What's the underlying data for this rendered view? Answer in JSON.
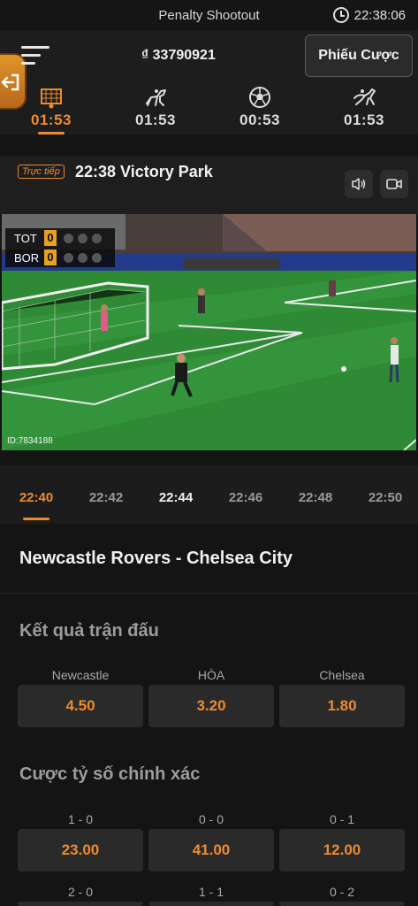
{
  "status": {
    "title": "Penalty Shootout",
    "clock": "22:38:06"
  },
  "header": {
    "balance": "₫ 33790921",
    "betslip_label": "Phiếu Cược",
    "sports": [
      {
        "icon": "goal-net-icon",
        "time": "01:53",
        "active": true
      },
      {
        "icon": "horse-racing-icon",
        "time": "01:53",
        "active": false
      },
      {
        "icon": "football-icon",
        "time": "00:53",
        "active": false
      },
      {
        "icon": "greyhound-icon",
        "time": "01:53",
        "active": false
      }
    ]
  },
  "live": {
    "badge": "Trực tiếp",
    "title": "22:38 Victory Park"
  },
  "video": {
    "home_team": "TOT",
    "home_score": "0",
    "away_team": "BOR",
    "away_score": "0",
    "stream_id": "ID:7834188"
  },
  "time_tabs": [
    {
      "label": "22:40",
      "state": "active"
    },
    {
      "label": "22:42",
      "state": "normal"
    },
    {
      "label": "22:44",
      "state": "bold"
    },
    {
      "label": "22:46",
      "state": "normal"
    },
    {
      "label": "22:48",
      "state": "normal"
    },
    {
      "label": "22:50",
      "state": "normal"
    }
  ],
  "match": {
    "title": "Newcastle Rovers - Chelsea City"
  },
  "markets": {
    "result": {
      "title": "Kết quả trận đấu",
      "options": [
        {
          "label": "Newcastle",
          "odds": "4.50"
        },
        {
          "label": "HÒA",
          "odds": "3.20"
        },
        {
          "label": "Chelsea",
          "odds": "1.80"
        }
      ]
    },
    "correct_score": {
      "title": "Cược tỷ số chính xác",
      "row1": [
        {
          "label": "1 - 0",
          "odds": "23.00"
        },
        {
          "label": "0 - 0",
          "odds": "41.00"
        },
        {
          "label": "0 - 1",
          "odds": "12.00"
        }
      ],
      "row2": [
        {
          "label": "2 - 0"
        },
        {
          "label": "1 - 1"
        },
        {
          "label": "0 - 2"
        }
      ]
    }
  },
  "colors": {
    "accent": "#f08a2c",
    "background": "#141414",
    "panel": "#2a2a2a"
  }
}
